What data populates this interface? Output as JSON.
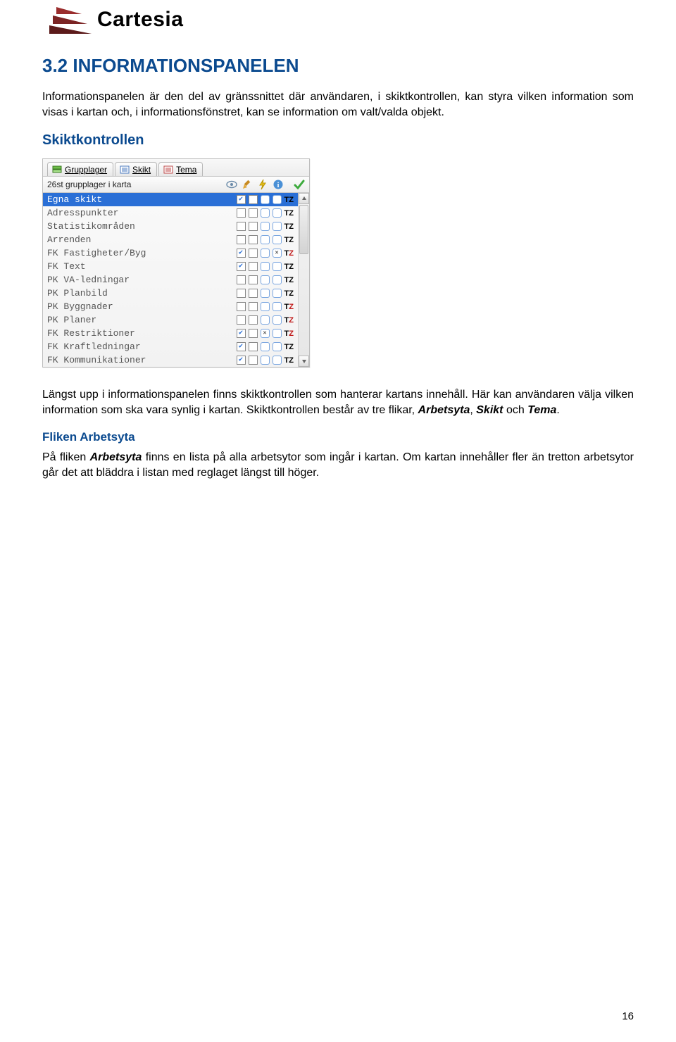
{
  "logo_text": "Cartesia",
  "heading": "3.2 INFORMATIONSPANELEN",
  "para1": "Informationspanelen är den del av gränssnittet där användaren, i skiktkontrollen, kan styra vilken information som visas i kartan och, i informationsfönstret, kan se information om valt/valda objekt.",
  "sub1": "Skiktkontrollen",
  "para2_a": "Längst upp i informationspanelen finns skiktkontrollen som hanterar kartans innehåll. Här kan användaren välja vilken information som ska vara synlig i kartan. Skiktkontrollen består av tre flikar, ",
  "para2_b": "Arbetsyta",
  "para2_c": ", ",
  "para2_d": "Skikt",
  "para2_e": " och ",
  "para2_f": "Tema",
  "para2_g": ".",
  "sub2": "Fliken Arbetsyta",
  "para3_a": "På fliken ",
  "para3_b": "Arbetsyta",
  "para3_c": " finns en lista på alla arbetsytor som ingår i kartan. Om kartan innehåller fler än tretton arbetsytor går det att bläddra i listan med reglaget längst till höger.",
  "panel": {
    "tabs": [
      {
        "label": "Grupplager",
        "icon": "layers-green"
      },
      {
        "label": "Skikt",
        "icon": "list-blue"
      },
      {
        "label": "Tema",
        "icon": "list-red"
      }
    ],
    "toolbar_text": "26st grupplager i karta",
    "rows": [
      {
        "name": "Egna skikt",
        "selected": true,
        "c1": true,
        "c2": false,
        "c3": false,
        "c4": false,
        "tzred": false
      },
      {
        "name": "Adresspunkter",
        "c1": false,
        "c2": false,
        "c3": false,
        "c4": false,
        "tzred": false
      },
      {
        "name": "Statistikområden",
        "c1": false,
        "c2": false,
        "c3": false,
        "c4": false,
        "tzred": false
      },
      {
        "name": "Arrenden",
        "c1": false,
        "c2": false,
        "c3": false,
        "c4": false,
        "tzred": false
      },
      {
        "name": "FK Fastigheter/Byg",
        "c1": true,
        "c2": false,
        "c3": false,
        "c4": "x",
        "tzred": true
      },
      {
        "name": "FK Text",
        "c1": true,
        "c2": false,
        "c3": false,
        "c4": false,
        "tzred": false
      },
      {
        "name": "PK VA-ledningar",
        "c1": false,
        "c2": false,
        "c3": false,
        "c4": false,
        "tzred": false
      },
      {
        "name": "PK Planbild",
        "c1": false,
        "c2": false,
        "c3": false,
        "c4": false,
        "tzred": false
      },
      {
        "name": "PK Byggnader",
        "c1": false,
        "c2": false,
        "c3": false,
        "c4": false,
        "tzred": true
      },
      {
        "name": "PK Planer",
        "c1": false,
        "c2": false,
        "c3": false,
        "c4": false,
        "tzred": true
      },
      {
        "name": "FK Restriktioner",
        "c1": true,
        "c2": false,
        "c3": "x",
        "c4": false,
        "tzred": true
      },
      {
        "name": "FK Kraftledningar",
        "c1": true,
        "c2": false,
        "c3": false,
        "c4": false,
        "tzred": false
      },
      {
        "name": "FK Kommunikationer",
        "c1": true,
        "c2": false,
        "c3": false,
        "c4": false,
        "tzred": false
      }
    ]
  },
  "page_number": "16"
}
